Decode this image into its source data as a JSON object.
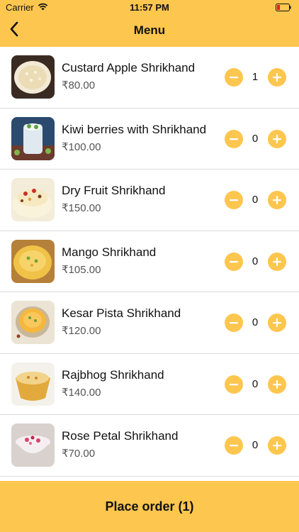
{
  "status_bar": {
    "carrier": "Carrier",
    "time": "11:57 PM"
  },
  "nav": {
    "title": "Menu",
    "back_icon": "chevron-left-icon"
  },
  "items": [
    {
      "name": "Custard Apple Shrikhand",
      "price": "₹80.00",
      "qty": "1"
    },
    {
      "name": "Kiwi berries with Shrikhand",
      "price": "₹100.00",
      "qty": "0"
    },
    {
      "name": "Dry Fruit Shrikhand",
      "price": "₹150.00",
      "qty": "0"
    },
    {
      "name": "Mango Shrikhand",
      "price": "₹105.00",
      "qty": "0"
    },
    {
      "name": "Kesar Pista Shrikhand",
      "price": "₹120.00",
      "qty": "0"
    },
    {
      "name": "Rajbhog Shrikhand",
      "price": "₹140.00",
      "qty": "0"
    },
    {
      "name": "Rose Petal Shrikhand",
      "price": "₹70.00",
      "qty": "0"
    }
  ],
  "footer": {
    "place_order_label": "Place order (1)"
  },
  "colors": {
    "accent": "#FDC64F",
    "divider": "#dcdcdc"
  }
}
